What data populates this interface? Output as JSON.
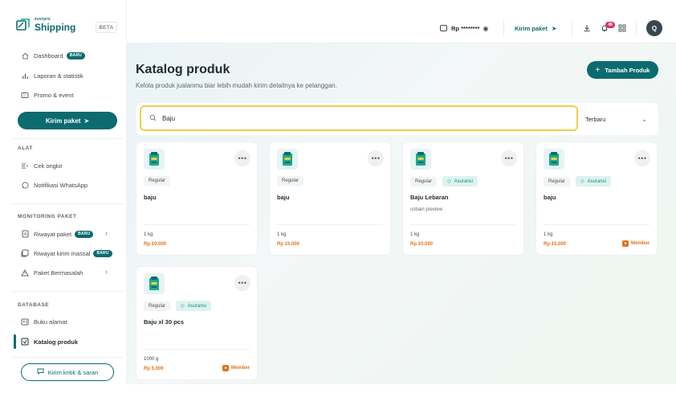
{
  "brand": {
    "small": "everpro",
    "name": "Shipping",
    "beta": "BETA"
  },
  "sidebar": {
    "main_items": [
      {
        "label": "Dashboard",
        "badge": "BARU"
      },
      {
        "label": "Laporan & statistik"
      },
      {
        "label": "Promo & event"
      }
    ],
    "kirim_paket": "Kirim paket",
    "sections": {
      "alat": "ALAT",
      "monitoring": "MONITORING PAKET",
      "database": "DATABASE"
    },
    "alat_items": [
      {
        "label": "Cek ongkir"
      },
      {
        "label": "Notifikasi WhatsApp"
      }
    ],
    "monitoring_items": [
      {
        "label": "Riwayat paket",
        "badge": "BARU"
      },
      {
        "label": "Riwayat kirim massal",
        "badge": "BARU"
      },
      {
        "label": "Paket Bermasalah"
      }
    ],
    "database_items": [
      {
        "label": "Buku alamat"
      },
      {
        "label": "Katalog produk"
      }
    ],
    "feedback": "Kirim kritik & saran"
  },
  "topbar": {
    "balance": "Rp ********",
    "kirim_paket": "Kirim paket",
    "notification_count": "48",
    "avatar_initial": "Q"
  },
  "page": {
    "title": "Katalog produk",
    "subtitle": "Kelola produk jualanmu biar lebih mudah kirim detailnya ke pelanggan.",
    "add_button": "Tambah Produk"
  },
  "search": {
    "value": "Baju",
    "placeholder": ""
  },
  "sort": {
    "selected": "Terbaru"
  },
  "products": [
    {
      "regular": "Regular",
      "asuransi": "",
      "name": "baju",
      "desc": "",
      "weight": "1 kg",
      "price": "Rp 10.000",
      "member": ""
    },
    {
      "regular": "Regular",
      "asuransi": "",
      "name": "baju",
      "desc": "",
      "weight": "1 kg",
      "price": "Rp 15.000",
      "member": ""
    },
    {
      "regular": "Regular",
      "asuransi": "Asuransi",
      "name": "Baju Lebaran",
      "desc": "cobain preview",
      "weight": "1 kg",
      "price": "Rp 10.000",
      "member": ""
    },
    {
      "regular": "Regular",
      "asuransi": "Asuransi",
      "name": "baju",
      "desc": "",
      "weight": "1 kg",
      "price": "Rp 15.000",
      "member": "Member"
    },
    {
      "regular": "Regular",
      "asuransi": "Asuransi",
      "name": "Baju xl 30 pcs",
      "desc": "",
      "weight": "1000 g",
      "price": "Rp 5.000",
      "member": "Member"
    }
  ],
  "icons": {
    "dashboard": "home-icon",
    "laporan": "bar-chart-icon",
    "promo": "ticket-icon",
    "cek_ongkir": "calculator-icon",
    "whatsapp": "whatsapp-icon",
    "riwayat": "document-icon",
    "massal": "documents-icon",
    "bermasalah": "warning-icon",
    "alamat": "address-book-icon",
    "katalog": "catalog-icon"
  },
  "colors": {
    "primary": "#0b6b6f",
    "accent_orange": "#e0741f",
    "search_focus": "#f2cf4a",
    "badge_pink": "#d6336c"
  }
}
